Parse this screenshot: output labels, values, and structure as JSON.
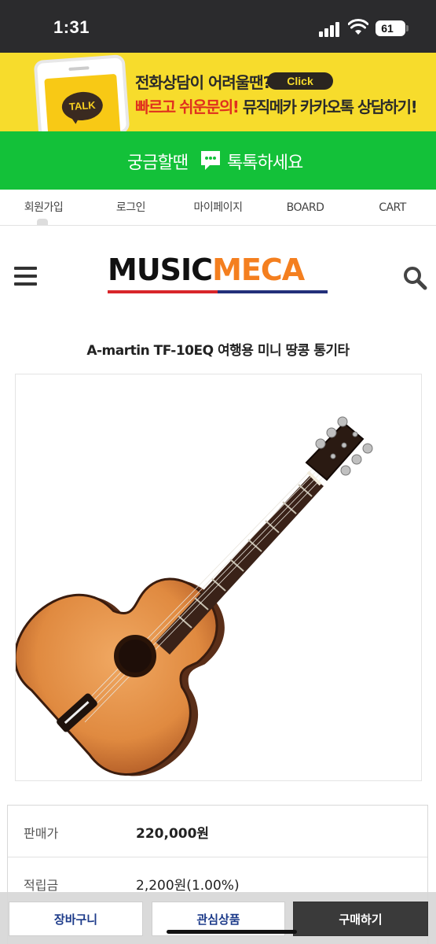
{
  "status": {
    "time": "1:31",
    "battery": "61"
  },
  "kakao_banner": {
    "talk_label": "TALK",
    "line1": "전화상담이 어려울땐?",
    "click_label": "Click",
    "line2_red": "빠르고 쉬운문의!",
    "line2_dark": "뮤직메카 카카오톡 상담하기!"
  },
  "green_banner": {
    "left": "궁금할땐",
    "right": "톡톡하세요"
  },
  "top_nav": [
    "회원가입",
    "로그인",
    "마이페이지",
    "BOARD",
    "CART"
  ],
  "header": {
    "logo_part1": "MUSIC",
    "logo_part2": "MECA"
  },
  "product": {
    "title": "A-martin TF-10EQ 여행용 미니 땅콩 통기타",
    "price_label": "판매가",
    "price_value": "220,000원",
    "points_label": "적립금",
    "points_value": "2,200원(1.00%)"
  },
  "bottom_bar": {
    "cart": "장바구니",
    "wishlist": "관심상품",
    "buy": "구매하기"
  },
  "colors": {
    "kakao_yellow": "#f7dc2c",
    "green": "#13c139",
    "logo_orange": "#f47f1f",
    "button_blue": "#1d3b8a"
  }
}
